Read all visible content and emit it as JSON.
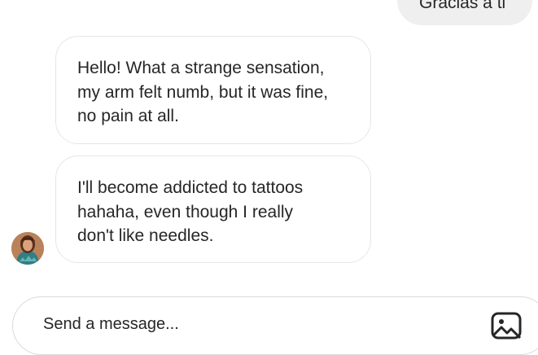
{
  "messages": [
    {
      "direction": "sent",
      "text": "Gracias a ti"
    },
    {
      "direction": "received",
      "text": "Hello! What a strange sensation,\nmy arm felt numb, but it was fine,\n no pain at all."
    },
    {
      "direction": "received",
      "text": "I'll become addicted to tattoos\nhahaha, even though I really\ndon't like needles."
    }
  ],
  "composer": {
    "placeholder": "Send a message..."
  },
  "icons": {
    "avatar": "user-avatar",
    "media": "image-icon"
  },
  "colors": {
    "sent_bubble": "#efefef",
    "received_border": "#e6e6e6",
    "text": "#262626"
  }
}
